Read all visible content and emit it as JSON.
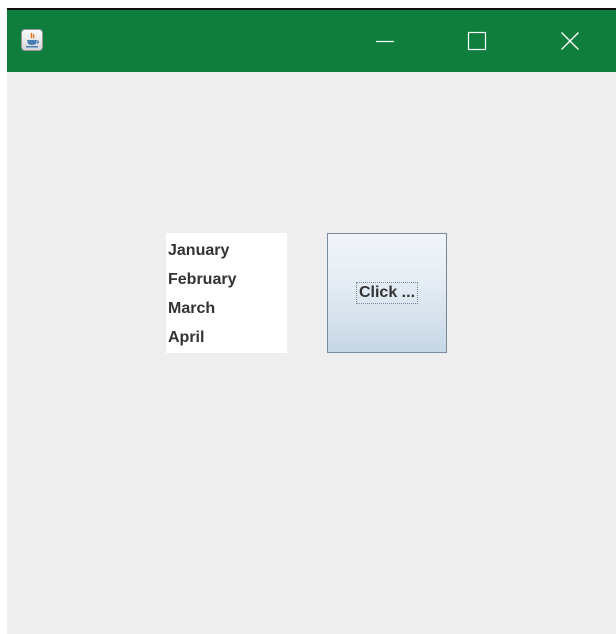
{
  "window": {
    "title": "",
    "titlebar_color": "#0f7e3c",
    "app_icon": "java-coffee-cup-icon",
    "controls": [
      "minimize-icon",
      "maximize-icon",
      "close-icon"
    ]
  },
  "month_list": {
    "items": [
      "January",
      "February",
      "March",
      "April"
    ]
  },
  "button": {
    "label": "Click ..."
  }
}
